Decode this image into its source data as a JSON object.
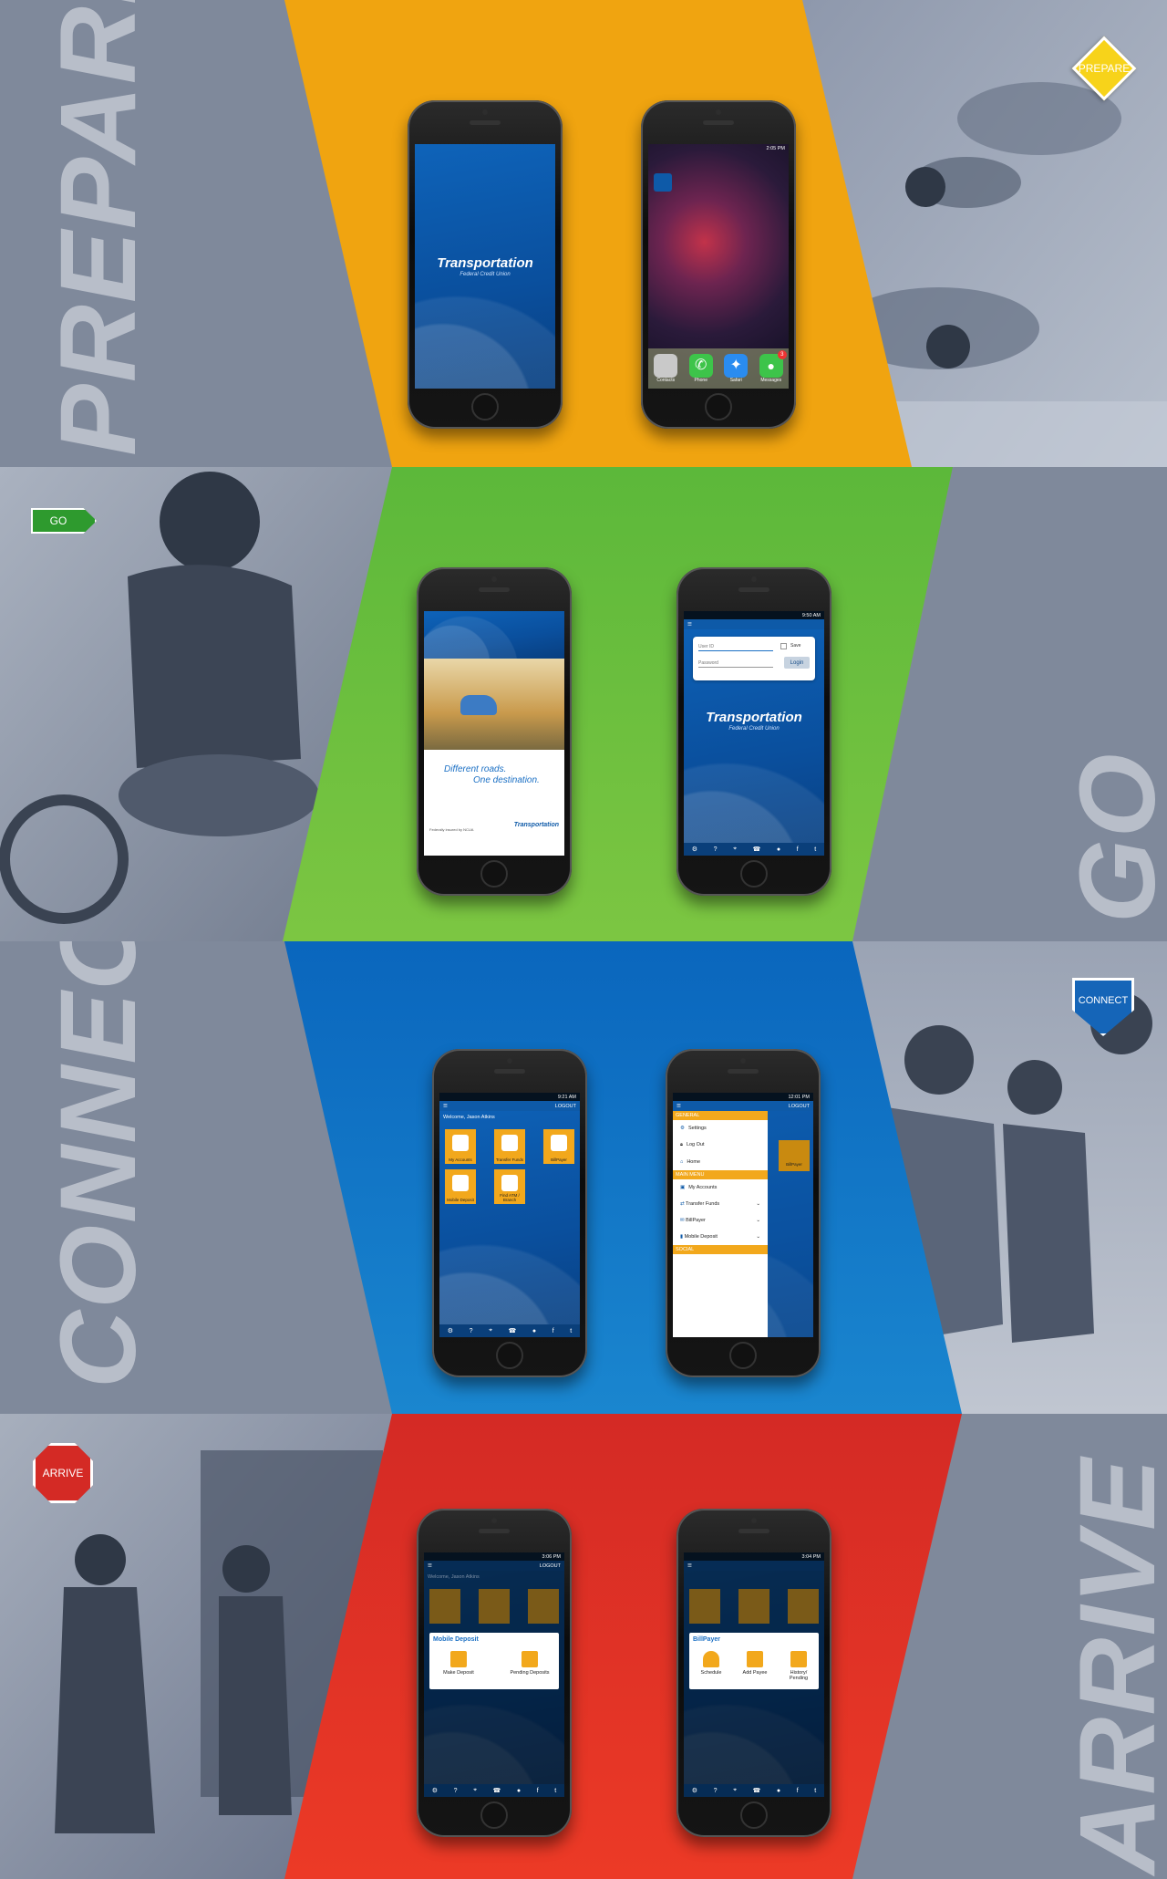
{
  "sections": {
    "prepare": {
      "word": "PREPARE",
      "badge": "PREPARE",
      "band_color": "#f0a410",
      "badge_color": "#f7d31a"
    },
    "go": {
      "word": "GO",
      "badge": "GO",
      "band_color": "#5cb83a",
      "badge_color": "#2e9a2e"
    },
    "connect": {
      "word": "CONNECT",
      "badge": "CONNECT",
      "band_color": "#0d6fc2",
      "badge_color": "#1565b8"
    },
    "arrive": {
      "word": "ARRIVE",
      "badge": "ARRIVE",
      "band_color": "#e03224",
      "badge_color": "#d42a25"
    }
  },
  "phones": {
    "splash": {
      "logo": "Transportation",
      "sub": "Federal Credit Union"
    },
    "home_screen": {
      "time": "2:05 PM",
      "dock": [
        "Contacts",
        "Phone",
        "Safari",
        "Messages"
      ],
      "badge_count": "3"
    },
    "promo": {
      "tagline_1": "Different roads.",
      "tagline_2": "One destination.",
      "footer_left": "Federally insured by NCUA",
      "logo": "Transportation"
    },
    "login": {
      "time": "9:50 AM",
      "userid_placeholder": "User ID",
      "save_label": "Save",
      "password_placeholder": "Password",
      "login_button": "Login",
      "logo": "Transportation",
      "sub": "Federal Credit Union"
    },
    "dashboard": {
      "time": "9:21 AM",
      "logout": "LOGOUT",
      "welcome": "Welcome, Jason Atkins",
      "tiles": [
        "My Accounts",
        "Transfer Funds",
        "BillPayer",
        "Mobile Deposit",
        "Find ATM / Branch"
      ]
    },
    "menu": {
      "time": "12:01 PM",
      "logout": "LOGOUT",
      "general_header": "GENERAL",
      "general_items": [
        "Settings",
        "Log Out",
        "Home"
      ],
      "main_header": "MAIN MENU",
      "main_items": [
        "My Accounts",
        "Transfer Funds",
        "BillPayer",
        "Mobile Deposit"
      ],
      "social_header": "SOCIAL",
      "peek_label": "BillPayer"
    },
    "deposit": {
      "time": "3:06 PM",
      "logout": "LOGOUT",
      "welcome": "Welcome, Jason Atkins",
      "popup_title": "Mobile Deposit",
      "actions": [
        "Make Deposit",
        "Pending Deposits"
      ]
    },
    "billpay": {
      "time": "3:04 PM",
      "popup_title": "BillPayer",
      "actions": [
        "Schedule",
        "Add Payee",
        "History/ Pending"
      ]
    }
  }
}
